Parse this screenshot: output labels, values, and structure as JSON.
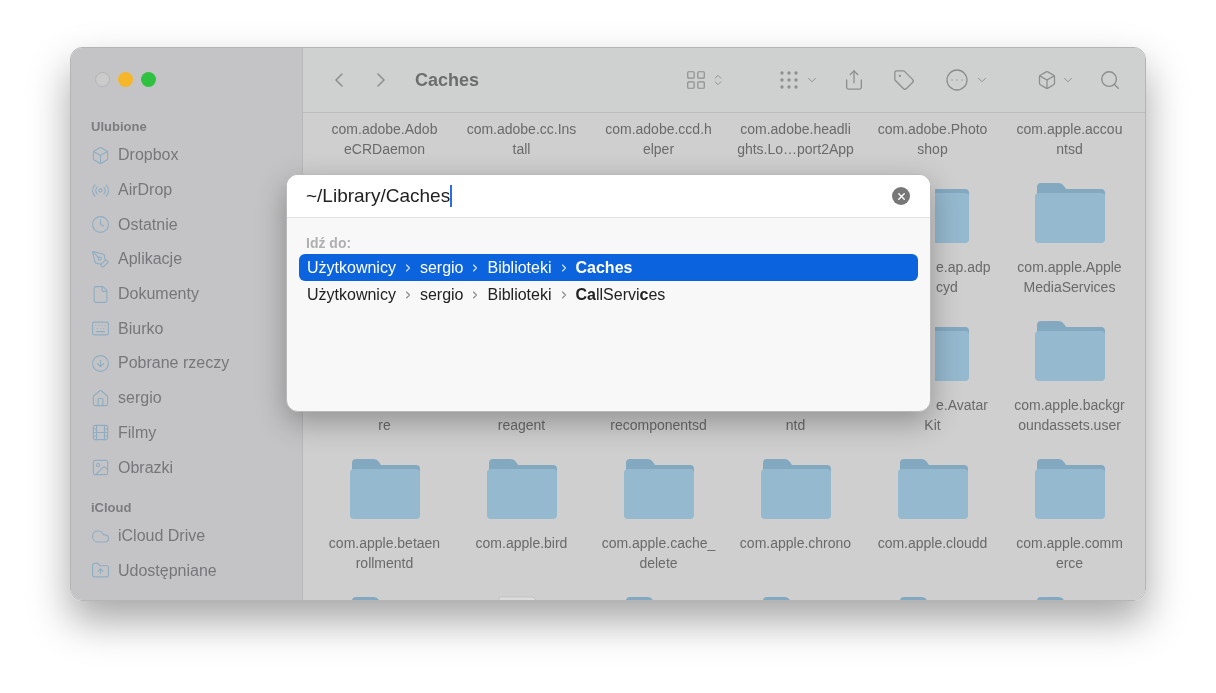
{
  "window": {
    "traffic_lights": [
      {
        "disabled": true
      },
      {
        "disabled": false
      },
      {
        "disabled": false
      }
    ]
  },
  "sidebar": {
    "sections": [
      {
        "title": "Ulubione",
        "items": [
          {
            "label": "Dropbox"
          },
          {
            "label": "AirDrop"
          },
          {
            "label": "Ostatnie"
          },
          {
            "label": "Aplikacje"
          },
          {
            "label": "Dokumenty"
          },
          {
            "label": "Biurko"
          },
          {
            "label": "Pobrane rzeczy"
          },
          {
            "label": "sergio"
          },
          {
            "label": "Filmy"
          },
          {
            "label": "Obrazki"
          }
        ]
      },
      {
        "title": "iCloud",
        "items": [
          {
            "label": "iCloud Drive"
          },
          {
            "label": "Udostępniane"
          }
        ]
      }
    ]
  },
  "toolbar": {
    "title": "Caches"
  },
  "grid": {
    "rows": [
      [
        {
          "line_1": {
            "text": "com.adobe.Adob",
            "cut": false
          },
          "line_2": {
            "text": "eCRDaemon",
            "cut": false
          }
        },
        {
          "line_1": {
            "text": "com.adobe.cc.Ins",
            "cut": false
          },
          "line_2": {
            "text": "tall",
            "cut": false
          }
        },
        {
          "line_1": {
            "text": "com.adobe.ccd.h",
            "cut": false
          },
          "line_2": {
            "text": "elper",
            "cut": false
          }
        },
        {
          "line_1": {
            "text": "com.adobe.headli",
            "cut": false
          },
          "line_2": {
            "text": "ghts.Lo…port2App",
            "cut": false
          }
        },
        {
          "line_1": {
            "text": "com.adobe.Photo",
            "cut": false
          },
          "line_2": {
            "text": "shop",
            "cut": false
          }
        },
        {
          "line_1": {
            "text": "com.apple.accou",
            "cut": false
          },
          "line_2": {
            "text": "ntsd",
            "cut": false
          }
        }
      ],
      [
        {
          "kind": "none"
        },
        {
          "kind": "none"
        },
        {
          "kind": "none"
        },
        {
          "kind": "none"
        },
        {
          "kind": "folder-cut",
          "line_1": {
            "text": "e.ap.adp",
            "cut": true
          },
          "line_2": {
            "text": "cyd",
            "cut": true
          }
        },
        {
          "kind": "folder",
          "line_1": {
            "text": "com.apple.Apple",
            "cut": false
          },
          "line_2": {
            "text": "MediaServices",
            "cut": false
          }
        }
      ],
      [
        {
          "kind": "none",
          "line_2": {
            "text": "re",
            "cut": false
          }
        },
        {
          "kind": "none",
          "line_2": {
            "text": "reagent",
            "cut": false
          }
        },
        {
          "kind": "none",
          "line_2": {
            "text": "recomponentsd",
            "cut": false
          }
        },
        {
          "kind": "none",
          "line_2": {
            "text": "ntd",
            "cut": false
          }
        },
        {
          "kind": "folder-cut",
          "line_1": {
            "text": "e.Avatar",
            "cut": true
          },
          "line_2": {
            "text": "Kit",
            "cut": false
          }
        },
        {
          "kind": "folder",
          "line_1": {
            "text": "com.apple.backgr",
            "cut": false
          },
          "line_2": {
            "text": "oundassets.user",
            "cut": false
          }
        }
      ],
      [
        {
          "kind": "folder",
          "line_1": {
            "text": "com.apple.betaen",
            "cut": false
          },
          "line_2": {
            "text": "rollmentd",
            "cut": false
          }
        },
        {
          "kind": "folder",
          "line_1": {
            "text": "com.apple.bird",
            "cut": false
          }
        },
        {
          "kind": "folder",
          "line_1": {
            "text": "com.apple.cache_",
            "cut": false
          },
          "line_2": {
            "text": "delete",
            "cut": false
          }
        },
        {
          "kind": "folder",
          "line_1": {
            "text": "com.apple.chrono",
            "cut": false
          }
        },
        {
          "kind": "folder",
          "line_1": {
            "text": "com.apple.cloudd",
            "cut": false
          }
        },
        {
          "kind": "folder",
          "line_1": {
            "text": "com.apple.comm",
            "cut": false
          },
          "line_2": {
            "text": "erce",
            "cut": false
          }
        }
      ],
      [
        {
          "kind": "folder"
        },
        {
          "kind": "file"
        },
        {
          "kind": "folder"
        },
        {
          "kind": "folder"
        },
        {
          "kind": "folder"
        },
        {
          "kind": "folder"
        }
      ]
    ]
  },
  "go_to_dialog": {
    "value": "~/Library/Caches",
    "section_label": "Idź do:",
    "suggestions": [
      {
        "selected": true,
        "segments": [
          "Użytkownicy",
          "sergio",
          "Biblioteki",
          "**Caches**"
        ]
      },
      {
        "selected": false,
        "segments": [
          "Użytkownicy",
          "sergio",
          "Biblioteki",
          "**Ca**llServi**c**es"
        ]
      }
    ]
  }
}
